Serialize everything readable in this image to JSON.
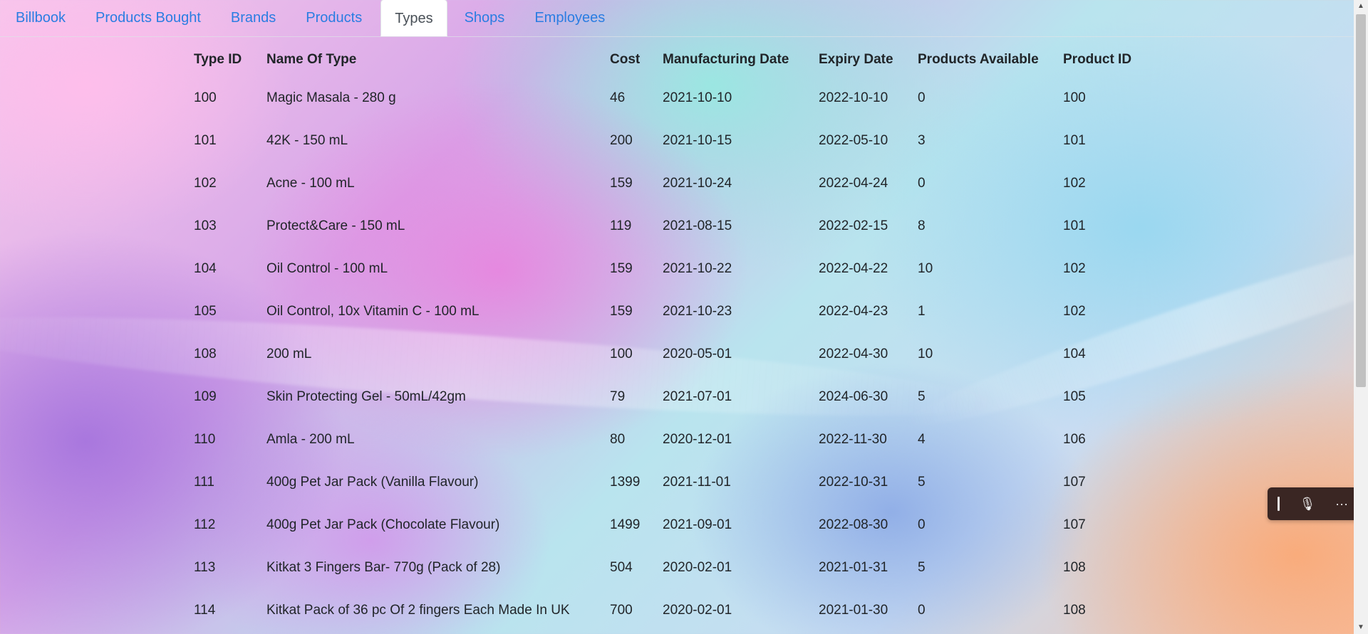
{
  "nav": {
    "items": [
      {
        "label": "Billbook"
      },
      {
        "label": "Products Bought"
      },
      {
        "label": "Brands"
      },
      {
        "label": "Products"
      },
      {
        "label": "Types",
        "active": true
      },
      {
        "label": "Shops"
      },
      {
        "label": "Employees"
      }
    ]
  },
  "table": {
    "headers": [
      "Type ID",
      "Name Of Type",
      "Cost",
      "Manufacturing Date",
      "Expiry Date",
      "Products Available",
      "Product ID"
    ],
    "rows": [
      [
        "100",
        "Magic Masala - 280 g",
        "46",
        "2021-10-10",
        "2022-10-10",
        "0",
        "100"
      ],
      [
        "101",
        "42K - 150 mL",
        "200",
        "2021-10-15",
        "2022-05-10",
        "3",
        "101"
      ],
      [
        "102",
        "Acne - 100 mL",
        "159",
        "2021-10-24",
        "2022-04-24",
        "0",
        "102"
      ],
      [
        "103",
        "Protect&Care - 150 mL",
        "119",
        "2021-08-15",
        "2022-02-15",
        "8",
        "101"
      ],
      [
        "104",
        "Oil Control - 100 mL",
        "159",
        "2021-10-22",
        "2022-04-22",
        "10",
        "102"
      ],
      [
        "105",
        "Oil Control, 10x Vitamin C - 100 mL",
        "159",
        "2021-10-23",
        "2022-04-23",
        "1",
        "102"
      ],
      [
        "108",
        "200 mL",
        "100",
        "2020-05-01",
        "2022-04-30",
        "10",
        "104"
      ],
      [
        "109",
        "Skin Protecting Gel - 50mL/42gm",
        "79",
        "2021-07-01",
        "2024-06-30",
        "5",
        "105"
      ],
      [
        "110",
        "Amla - 200 mL",
        "80",
        "2020-12-01",
        "2022-11-30",
        "4",
        "106"
      ],
      [
        "111",
        "400g Pet Jar Pack (Vanilla Flavour)",
        "1399",
        "2021-11-01",
        "2022-10-31",
        "5",
        "107"
      ],
      [
        "112",
        "400g Pet Jar Pack (Chocolate Flavour)",
        "1499",
        "2021-09-01",
        "2022-08-30",
        "0",
        "107"
      ],
      [
        "113",
        "Kitkat 3 Fingers Bar- 770g (Pack of 28)",
        "504",
        "2020-02-01",
        "2021-01-31",
        "5",
        "108"
      ],
      [
        "114",
        "Kitkat Pack of 36 pc Of 2 fingers Each Made In UK",
        "700",
        "2020-02-01",
        "2021-01-30",
        "0",
        "108"
      ]
    ]
  },
  "voice_toolbar": {
    "icons": [
      "drag-handle-icon",
      "microphone-icon",
      "more-options-icon"
    ],
    "mic_glyph": "🎙",
    "more_glyph": "···"
  },
  "scrollbar": {
    "up_glyph": "▲",
    "down_glyph": "▼"
  }
}
